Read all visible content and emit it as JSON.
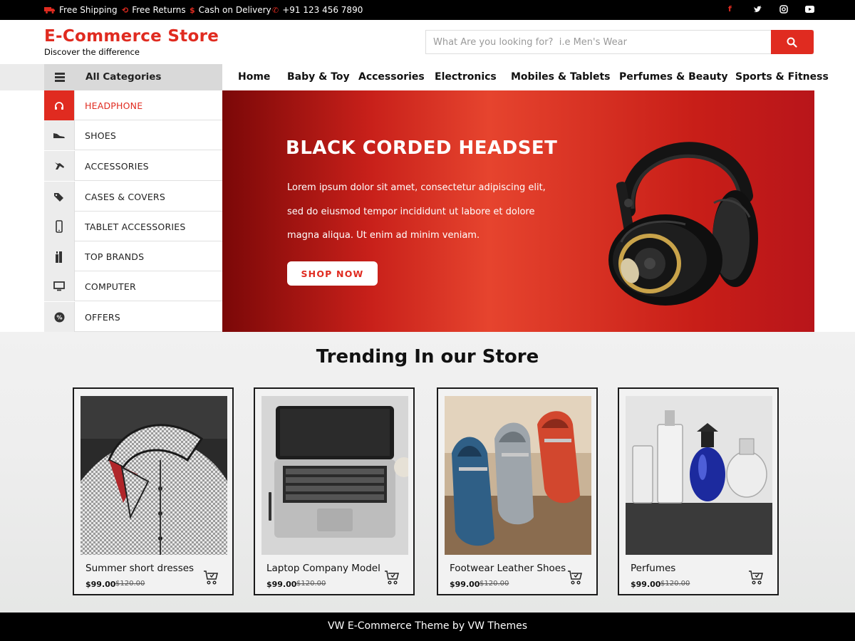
{
  "topbar": {
    "items": [
      {
        "icon": "truck-icon",
        "label": "Free Shipping"
      },
      {
        "icon": "returns-icon",
        "label": "Free Returns"
      },
      {
        "icon": "dollar-icon",
        "label": "Cash on Delivery"
      },
      {
        "icon": "phone-icon",
        "label": "+91 123 456 7890"
      }
    ],
    "social": [
      "facebook-icon",
      "twitter-icon",
      "instagram-icon",
      "youtube-icon"
    ]
  },
  "header": {
    "logo": "E-Commerce Store",
    "tagline": "Discover the difference",
    "search_placeholder": "What Are you looking for?  i.e Men's Wear"
  },
  "nav": {
    "all_categories": "All Categories",
    "links": [
      "Home",
      "Baby & Toy",
      "Accessories",
      "Electronics",
      "Mobiles & Tablets",
      "Perfumes & Beauty",
      "Sports & Fitness"
    ]
  },
  "categories": [
    {
      "label": "HEADPHONE",
      "icon": "headphone-icon",
      "active": true
    },
    {
      "label": "SHOES",
      "icon": "shoe-icon"
    },
    {
      "label": "ACCESSORIES",
      "icon": "accessories-icon"
    },
    {
      "label": "CASES & COVERS",
      "icon": "tags-icon"
    },
    {
      "label": "TABLET ACCESSORIES",
      "icon": "tablet-icon"
    },
    {
      "label": "TOP BRANDS",
      "icon": "brands-icon"
    },
    {
      "label": "COMPUTER",
      "icon": "monitor-icon"
    },
    {
      "label": "OFFERS",
      "icon": "percent-badge-icon"
    }
  ],
  "hero": {
    "title": "BLACK CORDED HEADSET",
    "text": "Lorem ipsum dolor sit amet, consectetur adipiscing elit, sed do eiusmod tempor incididunt ut labore et dolore magna aliqua. Ut enim ad minim veniam.",
    "button": "SHOP NOW"
  },
  "trending": {
    "title": "Trending In our Store",
    "products": [
      {
        "name": "Summer short dresses",
        "price": "$99.00",
        "old_price": "$120.00"
      },
      {
        "name": "Laptop Company Model",
        "price": "$99.00",
        "old_price": "$120.00"
      },
      {
        "name": "Footwear Leather Shoes",
        "price": "$99.00",
        "old_price": "$120.00"
      },
      {
        "name": "Perfumes",
        "price": "$99.00",
        "old_price": "$120.00"
      }
    ]
  },
  "footer": {
    "text": "VW E-Commerce Theme by VW Themes"
  },
  "colors": {
    "accent": "#e02b20",
    "topbar": "#000000",
    "footer": "#000000"
  }
}
